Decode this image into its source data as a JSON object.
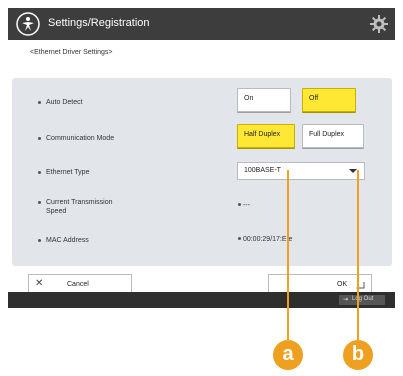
{
  "header": {
    "title": "Settings/Registration"
  },
  "breadcrumb": "<Ethernet Driver Settings>",
  "rows": {
    "auto_detect": {
      "label": "Auto Detect",
      "on": "On",
      "off": "Off"
    },
    "communication_mode": {
      "label": "Communication Mode",
      "half": "Half Duplex",
      "full": "Full Duplex"
    },
    "ethernet_type": {
      "label": "Ethernet Type",
      "value": "100BASE-T"
    },
    "transmission_speed": {
      "label_line1": "Current Transmission",
      "label_line2": "Speed",
      "value": "---"
    },
    "mac_address": {
      "label": "MAC Address",
      "value": "00:00:29/17:E:e"
    }
  },
  "footer": {
    "cancel": "Cancel",
    "ok": "OK"
  },
  "statusbar": {
    "logout": "Log Out"
  },
  "callouts": {
    "a": "a",
    "b": "b"
  },
  "colors": {
    "header": "#3d3d3d",
    "selected": "#ffe833",
    "panel": "#e2e6ea",
    "callout": "#f0a020"
  }
}
